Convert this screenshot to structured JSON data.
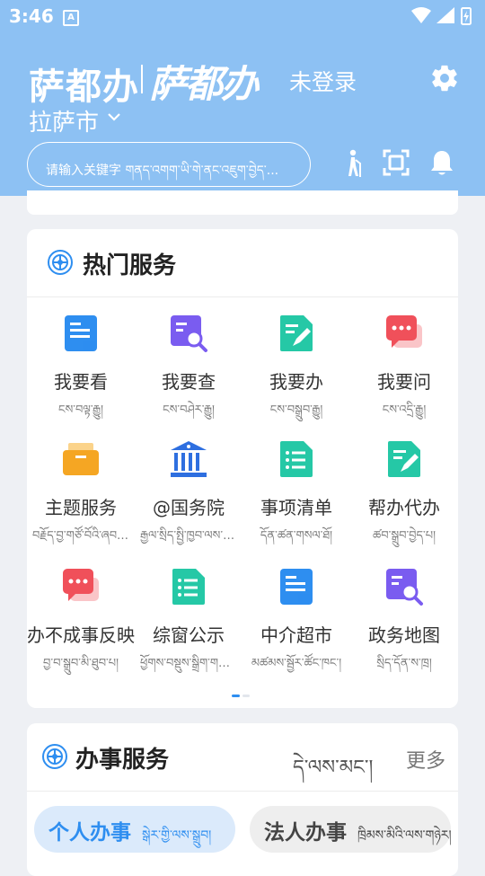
{
  "status_bar": {
    "time": "3:46",
    "notification": "A"
  },
  "header": {
    "brand": "萨都办",
    "brand_calligraphy": "萨都办",
    "login_status": "未登录",
    "city": "拉萨市",
    "search_placeholder": "请输入关键字 གནད་འགག་ཡི་གེ་ནང་འཇུག་བྱེད་..."
  },
  "hot_services": {
    "title": "热门服务",
    "items": [
      {
        "label": "我要看",
        "tib": "ངས་བལྟ་རྒྱུ།",
        "icon": "document-list-icon",
        "color": "#2e8ef0"
      },
      {
        "label": "我要查",
        "tib": "ངས་བཤེར་རྒྱུ།",
        "icon": "search-document-icon",
        "color": "#7a5cf0"
      },
      {
        "label": "我要办",
        "tib": "ངས་བསྒྲུབ་རྒྱུ།",
        "icon": "edit-document-icon",
        "color": "#25c8a6"
      },
      {
        "label": "我要问",
        "tib": "ངས་འདྲི་རྒྱུ།",
        "icon": "chat-bubble-icon",
        "color": "#f0505a"
      },
      {
        "label": "主题服务",
        "tib": "བརྗོད་བྱ་གཙོ་བོའི་ཞབས་ཞུ།",
        "icon": "folder-icon",
        "color": "#f5a623"
      },
      {
        "label": "@国务院",
        "tib": "རྒྱལ་སྲིད་སྤྱི་ཁྱབ་ལས་ཁུངས།",
        "icon": "government-building-icon",
        "color": "#2e6fe0"
      },
      {
        "label": "事项清单",
        "tib": "དོན་ཚན་གསལ་ཐོ།",
        "icon": "checklist-icon",
        "color": "#25c8a6"
      },
      {
        "label": "帮办代办",
        "tib": "ཚབ་སྒྲུབ་བྱེད་པ།",
        "icon": "edit-document-icon",
        "color": "#25c8a6"
      },
      {
        "label": "办不成事反映",
        "tib": "བྱ་བ་སྒྲུབ་མི་ཐུབ་པ།",
        "icon": "chat-bubble-icon",
        "color": "#f0505a"
      },
      {
        "label": "综窗公示",
        "tib": "ཕྱོགས་བསྡུས་སྒྲིག་གསལ་བསྒྲགས།",
        "icon": "checklist-icon",
        "color": "#25c8a6"
      },
      {
        "label": "中介超市",
        "tib": "མཚམས་སྦྱོར་ཚོང་ཁང་།",
        "icon": "document-list-icon",
        "color": "#2e8ef0"
      },
      {
        "label": "政务地图",
        "tib": "སྲིད་དོན་ས་ཁྲ།",
        "icon": "search-document-icon",
        "color": "#7a5cf0"
      }
    ]
  },
  "affairs": {
    "title": "办事服务",
    "title_tib": "དེ་ལས་མང་།",
    "more": "更多",
    "tabs": [
      {
        "label": "个人办事",
        "tib": "སྒེར་གྱི་ལས་སྒྲུབ།"
      },
      {
        "label": "法人办事",
        "tib": "ཁྲིམས་མིའི་ལས་གཉེར།"
      }
    ]
  },
  "colors": {
    "header_bg": "#8dc1f3",
    "accent": "#2e8ef0",
    "page_bg": "#eef0f4"
  }
}
